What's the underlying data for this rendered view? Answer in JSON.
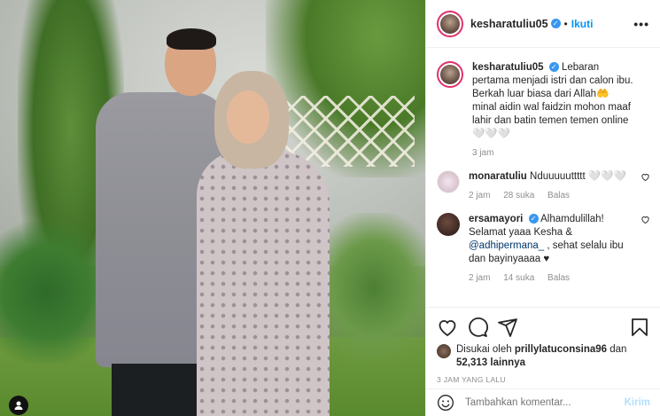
{
  "post": {
    "author": "kesharatuliu05",
    "follow_label": "Ikuti",
    "more_label": "•••"
  },
  "caption": {
    "author": "kesharatuliu05",
    "text": "Lebaran pertama menjadi istri dan calon ibu. Berkah luar biasa dari Allah🤲 minal aidin wal faidzin mohon maaf lahir dan batin temen temen online🤍🤍🤍",
    "time": "3 jam"
  },
  "comments": [
    {
      "author": "monaratuliu",
      "text": "Nduuuuuttttt 🤍🤍🤍",
      "time": "2 jam",
      "likes": "28 suka",
      "reply": "Balas"
    },
    {
      "author": "ersamayori",
      "text_before": "Alhamdulillah! Selamat yaaa Kesha & ",
      "mention": "@adhipermana_",
      "text_after": " , sehat selalu ibu dan bayinyaaaa ♥",
      "time": "2 jam",
      "likes": "14 suka",
      "reply": "Balas"
    }
  ],
  "likes": {
    "prefix": "Disukai oleh",
    "first_user": "prillylatuconsina96",
    "connector": "dan",
    "count": "52,313 lainnya"
  },
  "timestamp": "3 JAM YANG LALU",
  "add_comment": {
    "placeholder": "Tambahkan komentar...",
    "send_label": "Kirim"
  },
  "icons": {
    "like": "heart-icon",
    "comment": "comment-icon",
    "share": "share-icon",
    "save": "bookmark-icon",
    "emoji": "emoji-icon",
    "tag": "user-tag-icon"
  },
  "colors": {
    "accent": "#0095f6",
    "verified": "#3897f0",
    "story_ring": "#e1306c",
    "muted": "#8e8e8e"
  }
}
